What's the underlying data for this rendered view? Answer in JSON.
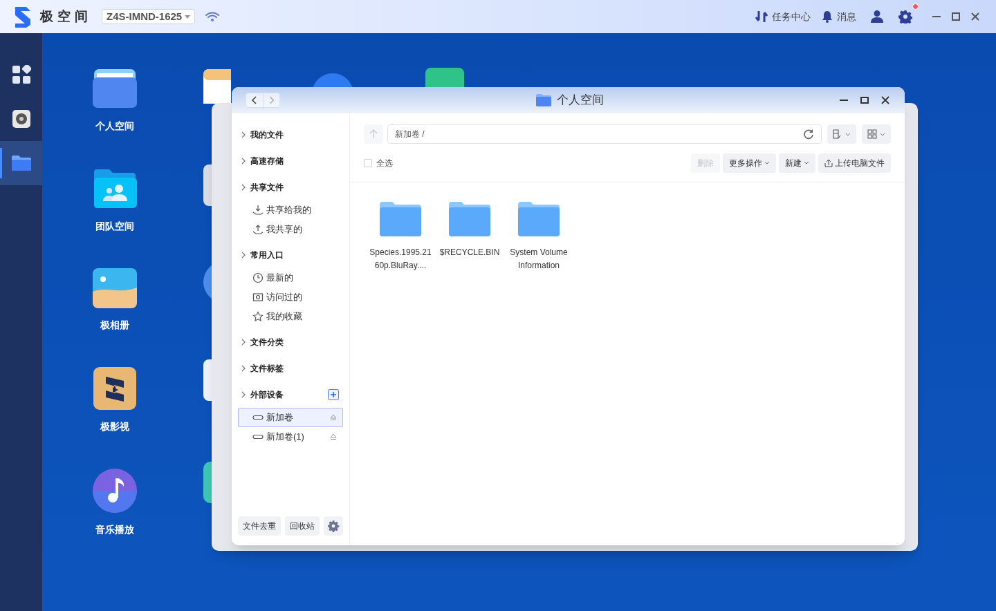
{
  "topbar": {
    "app_name": "极空间",
    "device": "Z4S-IMND-1625",
    "tasks": "任务中心",
    "messages": "消息",
    "settings_alert": true
  },
  "dock": [
    {
      "kind": "apps",
      "selected": false
    },
    {
      "kind": "disk",
      "selected": false
    },
    {
      "kind": "folder",
      "selected": true
    }
  ],
  "desktop_icons": [
    {
      "kind": "personal",
      "label": "个人空间"
    },
    {
      "kind": "team",
      "label": "团队空间"
    },
    {
      "kind": "photos",
      "label": "极相册"
    },
    {
      "kind": "video",
      "label": "极影视"
    },
    {
      "kind": "music",
      "label": "音乐播放"
    }
  ],
  "window": {
    "title": "个人空间",
    "sidebar": [
      {
        "label": "我的文件"
      },
      {
        "label": "高速存储"
      },
      {
        "label": "共享文件",
        "children": [
          {
            "kind": "shared-in",
            "label": "共享给我的",
            "selected": false,
            "ejectable": false
          },
          {
            "kind": "shared-out",
            "label": "我共享的",
            "selected": false,
            "ejectable": false
          }
        ]
      },
      {
        "label": "常用入口",
        "children": [
          {
            "kind": "recent",
            "label": "最新的",
            "selected": false,
            "ejectable": false
          },
          {
            "kind": "visited",
            "label": "访问过的",
            "selected": false,
            "ejectable": false
          },
          {
            "kind": "favorite",
            "label": "我的收藏",
            "selected": false,
            "ejectable": false
          }
        ]
      },
      {
        "label": "文件分类"
      },
      {
        "label": "文件标签"
      },
      {
        "label": "外部设备",
        "addable": true,
        "children": [
          {
            "kind": "volume",
            "label": "新加卷",
            "selected": true,
            "ejectable": true
          },
          {
            "kind": "volume",
            "label": "新加卷(1)",
            "selected": false,
            "ejectable": true
          }
        ]
      }
    ],
    "sidebar_buttons": [
      "文件去重",
      "回收站"
    ],
    "path": "新加卷 /",
    "select_all": {
      "label": "全选",
      "checked": false
    },
    "actions": [
      {
        "label": "删除",
        "disabled": true,
        "dropdown": false,
        "upload": false
      },
      {
        "label": "更多操作",
        "disabled": false,
        "dropdown": true,
        "upload": false
      },
      {
        "label": "新建",
        "disabled": false,
        "dropdown": true,
        "upload": false
      },
      {
        "label": "上传电脑文件",
        "disabled": false,
        "dropdown": false,
        "upload": true
      }
    ],
    "files": [
      {
        "name": "Species.1995.2160p.BluRay...."
      },
      {
        "name": "$RECYCLE.BIN"
      },
      {
        "name": "System Volume Information"
      }
    ]
  }
}
